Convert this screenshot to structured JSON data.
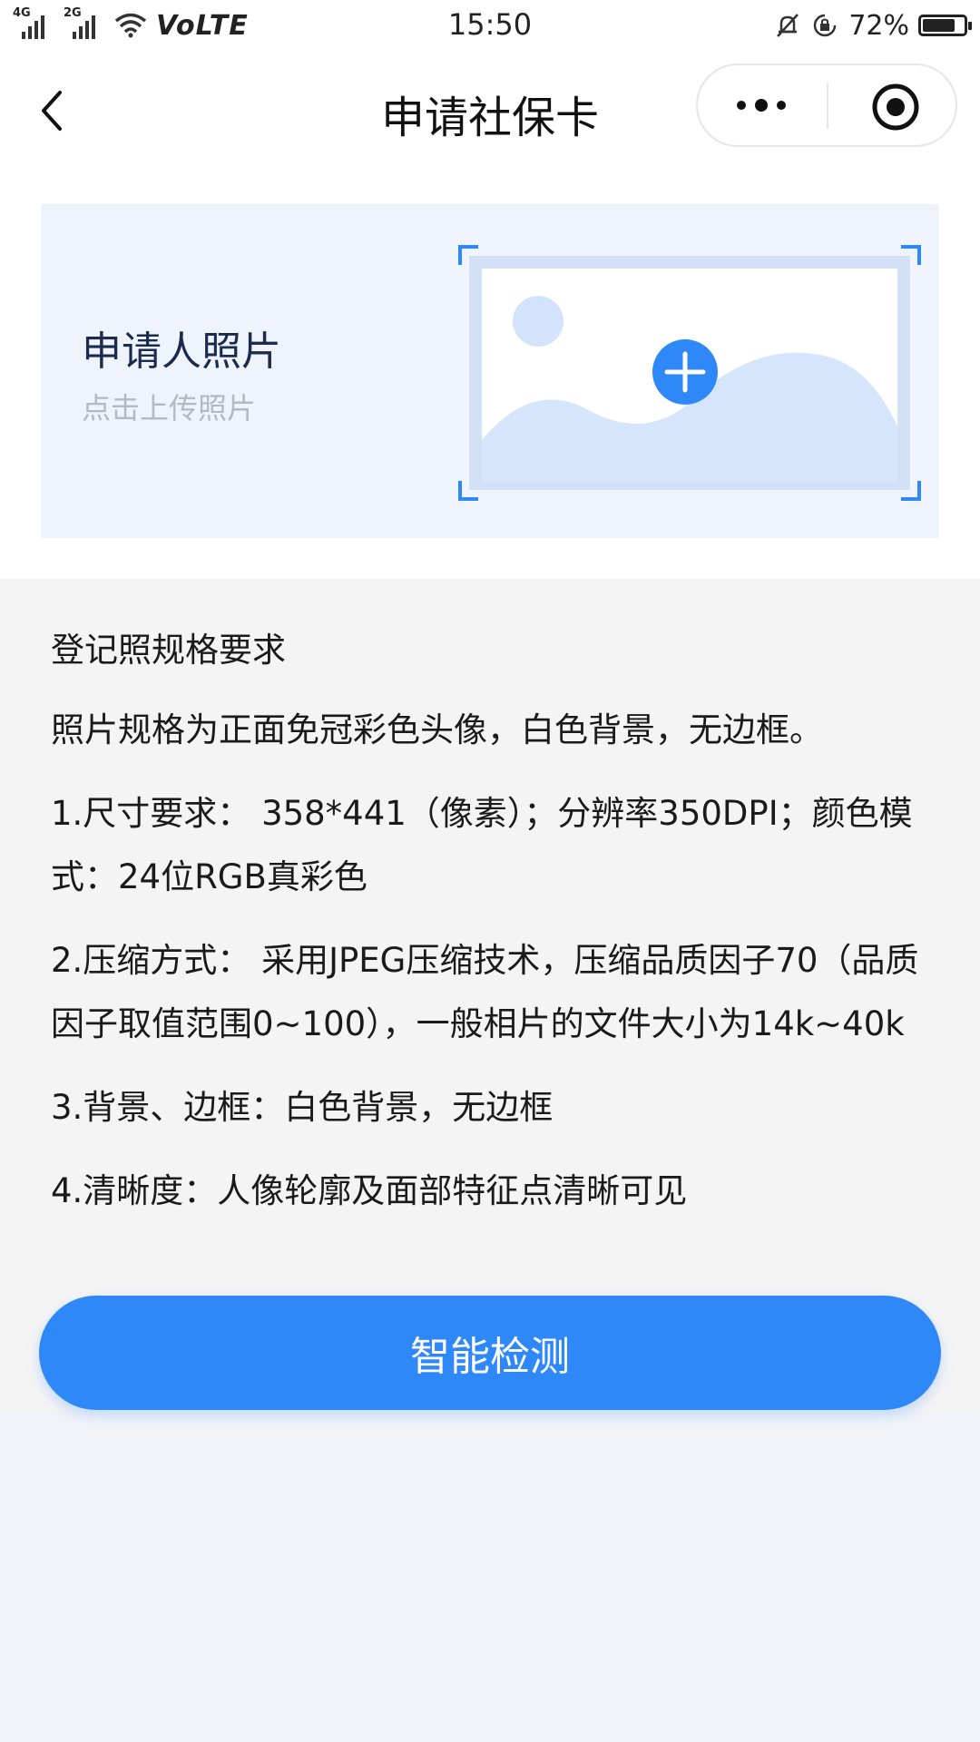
{
  "status_bar": {
    "network_tags": [
      "4G",
      "2G"
    ],
    "volte": "VoLTE",
    "time": "15:50",
    "battery": "72%",
    "battery_level": 0.72,
    "icons": [
      "signal-icon",
      "wifi-icon",
      "mute-icon",
      "rotation-lock-icon",
      "battery-icon"
    ]
  },
  "nav": {
    "title": "申请社保卡",
    "icons": [
      "back-icon",
      "more-icon",
      "close-icon"
    ]
  },
  "upload": {
    "title": "申请人照片",
    "hint": "点击上传照片",
    "icon": "add-photo-icon"
  },
  "requirements": {
    "heading": "登记照规格要求",
    "items": [
      "照片规格为正面免冠彩色头像，白色背景，无边框。",
      "1.尺寸要求： 358*441（像素）；分辨率350DPI；颜色模式：24位RGB真彩色",
      "2.压缩方式： 采用JPEG压缩技术，压缩品质因子70（品质因子取值范围0~100），一般相片的文件大小为14k~40k",
      "3.背景、边框：白色背景，无边框",
      "4.清晰度：人像轮廓及面部特征点清晰可见"
    ]
  },
  "button": {
    "label": "智能检测"
  },
  "colors": {
    "accent": "#2f88f7",
    "card_bg": "#eef3fc",
    "page_bg": "#f1f3f8"
  }
}
